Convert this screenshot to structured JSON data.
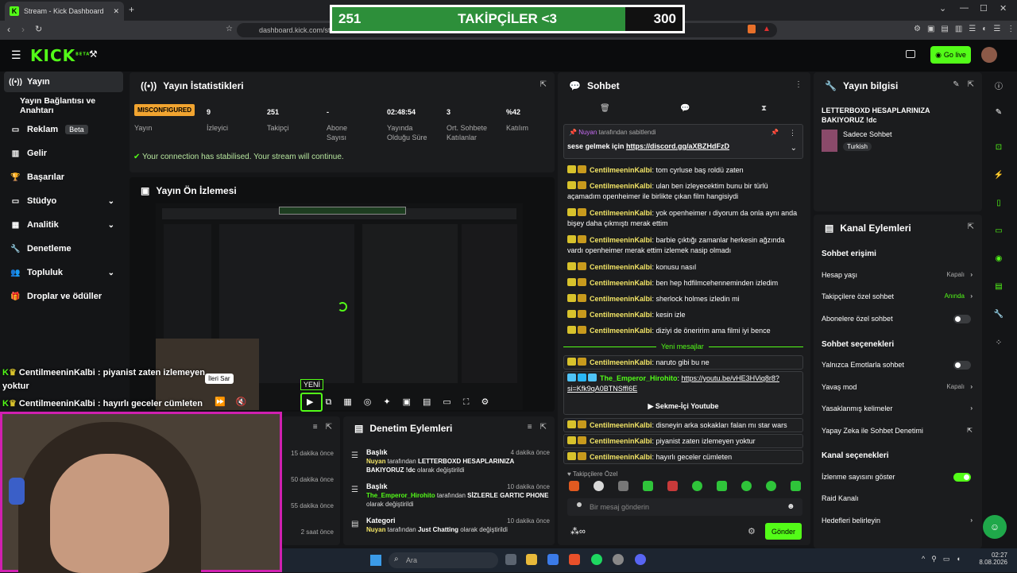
{
  "browser": {
    "tab_title": "Stream - Kick Dashboard",
    "url": "dashboard.kick.com/str"
  },
  "overlay": {
    "goal_left": "251",
    "goal_label": "TAKİPÇİLER <3",
    "goal_right": "300",
    "progress": 0.837
  },
  "header": {
    "logo": "KICK",
    "logo_sup": "BETA",
    "go_live": "Go live"
  },
  "sidebar": {
    "items": [
      {
        "label": "Yayın",
        "icon": "broadcast-icon"
      },
      {
        "label": "Yayın Bağlantısı ve Anahtarı",
        "icon": ""
      },
      {
        "label": "Reklam",
        "badge": "Beta",
        "icon": "tv-icon"
      },
      {
        "label": "Gelir",
        "icon": "chart-icon"
      },
      {
        "label": "Başarılar",
        "icon": "trophy-icon"
      },
      {
        "label": "Stüdyo",
        "icon": "studio-icon"
      },
      {
        "label": "Analitik",
        "icon": "analytics-icon"
      },
      {
        "label": "Denetleme",
        "icon": "wrench-icon"
      },
      {
        "label": "Topluluk",
        "icon": "community-icon"
      },
      {
        "label": "Droplar ve ödüller",
        "icon": "gift-icon"
      }
    ]
  },
  "stats": {
    "title": "Yayın İstatistikleri",
    "items": [
      {
        "value": "MISCONFIGURED",
        "label": "Yayın"
      },
      {
        "value": "9",
        "label": "İzleyici"
      },
      {
        "value": "251",
        "label": "Takipçi"
      },
      {
        "value": "-",
        "label": "Abone Sayısı"
      },
      {
        "value": "02:48:54",
        "label": "Yayında Olduğu Süre"
      },
      {
        "value": "3",
        "label": "Ort. Sohbete Katılanlar"
      },
      {
        "value": "%42",
        "label": "Katılım"
      }
    ],
    "connection": "Your connection has stabilised. Your stream will continue."
  },
  "preview": {
    "title": "Yayın Ön İzlemesi",
    "tooltip": "İleri Sar",
    "new_badge": "YENİ"
  },
  "overlay_chat": [
    {
      "user": "CentilmeeninKalbi",
      "text": " : piyanist zaten izlemeyen",
      "cont": "yoktur"
    },
    {
      "user": "CentilmeeninKalbi",
      "text": " : hayırlı geceler cümleten"
    }
  ],
  "moderation": {
    "title": "Denetim Eylemleri",
    "times": [
      "15 dakika önce",
      "50 dakika önce",
      "55 dakika önce",
      "2 saat önce"
    ],
    "items": [
      {
        "type": "Başlık",
        "time": "4 dakika önce",
        "user": "Nuyan",
        "mid": " tarafından ",
        "value": "LETTERBOXD HESAPLARINIZA BAKIYORUZ !dc",
        "tail": " olarak değiştirildi"
      },
      {
        "type": "Başlık",
        "time": "10 dakika önce",
        "user": "The_Emperor_Hirohito",
        "mid": " tarafından ",
        "value": "SİZLERLE GARTIC PHONE",
        "tail": " olarak değiştirildi"
      },
      {
        "type": "Kategori",
        "time": "10 dakika önce",
        "user": "Nuyan",
        "mid": " tarafından ",
        "value": "Just Chatting",
        "tail": " olarak değiştirildi"
      }
    ]
  },
  "chat": {
    "title": "Sohbet",
    "pinned_by": "Nuyan",
    "pinned_suffix": " tarafından sabitlendi",
    "pinned_text": "sese gelmek için ",
    "pinned_link": "https://discord.gg/aXBZHdFzD",
    "messages": [
      {
        "user": "CentilmeeninKalbi",
        "text": "tom cyrluse baş roldü zaten"
      },
      {
        "user": "CentilmeeninKalbi",
        "text": "ulan ben izleyecektim bunu bir türlü açamadım openheimer ile birlikte çıkan film hangisiydi"
      },
      {
        "user": "CentilmeeninKalbi",
        "text": "yok openheimer ı diyorum da onla aynı anda bişey daha çıkmıştı merak ettim"
      },
      {
        "user": "CentilmeeninKalbi",
        "text": "barbie çıktığı zamanlar herkesin ağzında vardı openheimer merak ettim izlemek nasip olmadı"
      },
      {
        "user": "CentilmeeninKalbi",
        "text": "konusu nasıl"
      },
      {
        "user": "CentilmeeninKalbi",
        "text": "ben hep hdfilmcehenneminden izledim"
      },
      {
        "user": "CentilmeeninKalbi",
        "text": "sherlock holmes izledin mi"
      },
      {
        "user": "CentilmeeninKalbi",
        "text": "kesin izle"
      },
      {
        "user": "CentilmeeninKalbi",
        "text": "diziyi de öneririm ama filmi iyi bence"
      }
    ],
    "new_messages": "Yeni mesajlar",
    "new": [
      {
        "user": "CentilmeeninKalbi",
        "text": "naruto gibi bu ne"
      },
      {
        "user": "The_Emperor_Hirohito",
        "link": "https://youtu.be/vHE3HViq8r8?si=Kfk9qA0BTNSffI6E",
        "embed": "Sekme-İçi Youtube"
      },
      {
        "user": "CentilmeeninKalbi",
        "text": "disneyin arka sokakları falan mı star wars"
      },
      {
        "user": "CentilmeeninKalbi",
        "text": "piyanist zaten izlemeyen yoktur"
      },
      {
        "user": "CentilmeeninKalbi",
        "text": "hayırlı geceler cümleten"
      }
    ],
    "emote_label": "Takipçilere Özel",
    "input_placeholder": "Bir mesaj gönderin",
    "send": "Gönder"
  },
  "stream_info": {
    "title": "Yayın bilgisi",
    "stream_title": "LETTERBOXD HESAPLARINIZA BAKIYORUZ !dc",
    "category": "Sadece Sohbet",
    "tag": "Turkish"
  },
  "channel_actions": {
    "title": "Kanal Eylemleri",
    "chat_access": "Sohbet erişimi",
    "account_age": "Hesap yaşı",
    "account_age_val": "Kapalı",
    "followers_only": "Takipçilere özel sohbet",
    "followers_only_val": "Anında",
    "subs_only": "Abonelere özel sohbet",
    "chat_options": "Sohbet seçenekleri",
    "emote_only": "Yalnızca Emotlarla sohbet",
    "slow_mode": "Yavaş mod",
    "slow_mode_val": "Kapalı",
    "banned_words": "Yasaklanmış kelimeler",
    "ai_mod": "Yapay Zeka ile Sohbet Denetimi",
    "channel_options": "Kanal seçenekleri",
    "show_viewers": "İzlenme sayısını göster",
    "raid": "Raid Kanalı",
    "goals": "Hedefleri belirleyin"
  },
  "taskbar": {
    "search": "Ara",
    "time": "02:27",
    "date": "8.08.2026"
  },
  "colors": {
    "accent": "#53fc18",
    "panel": "#1b1c1e",
    "bg": "#141517"
  }
}
